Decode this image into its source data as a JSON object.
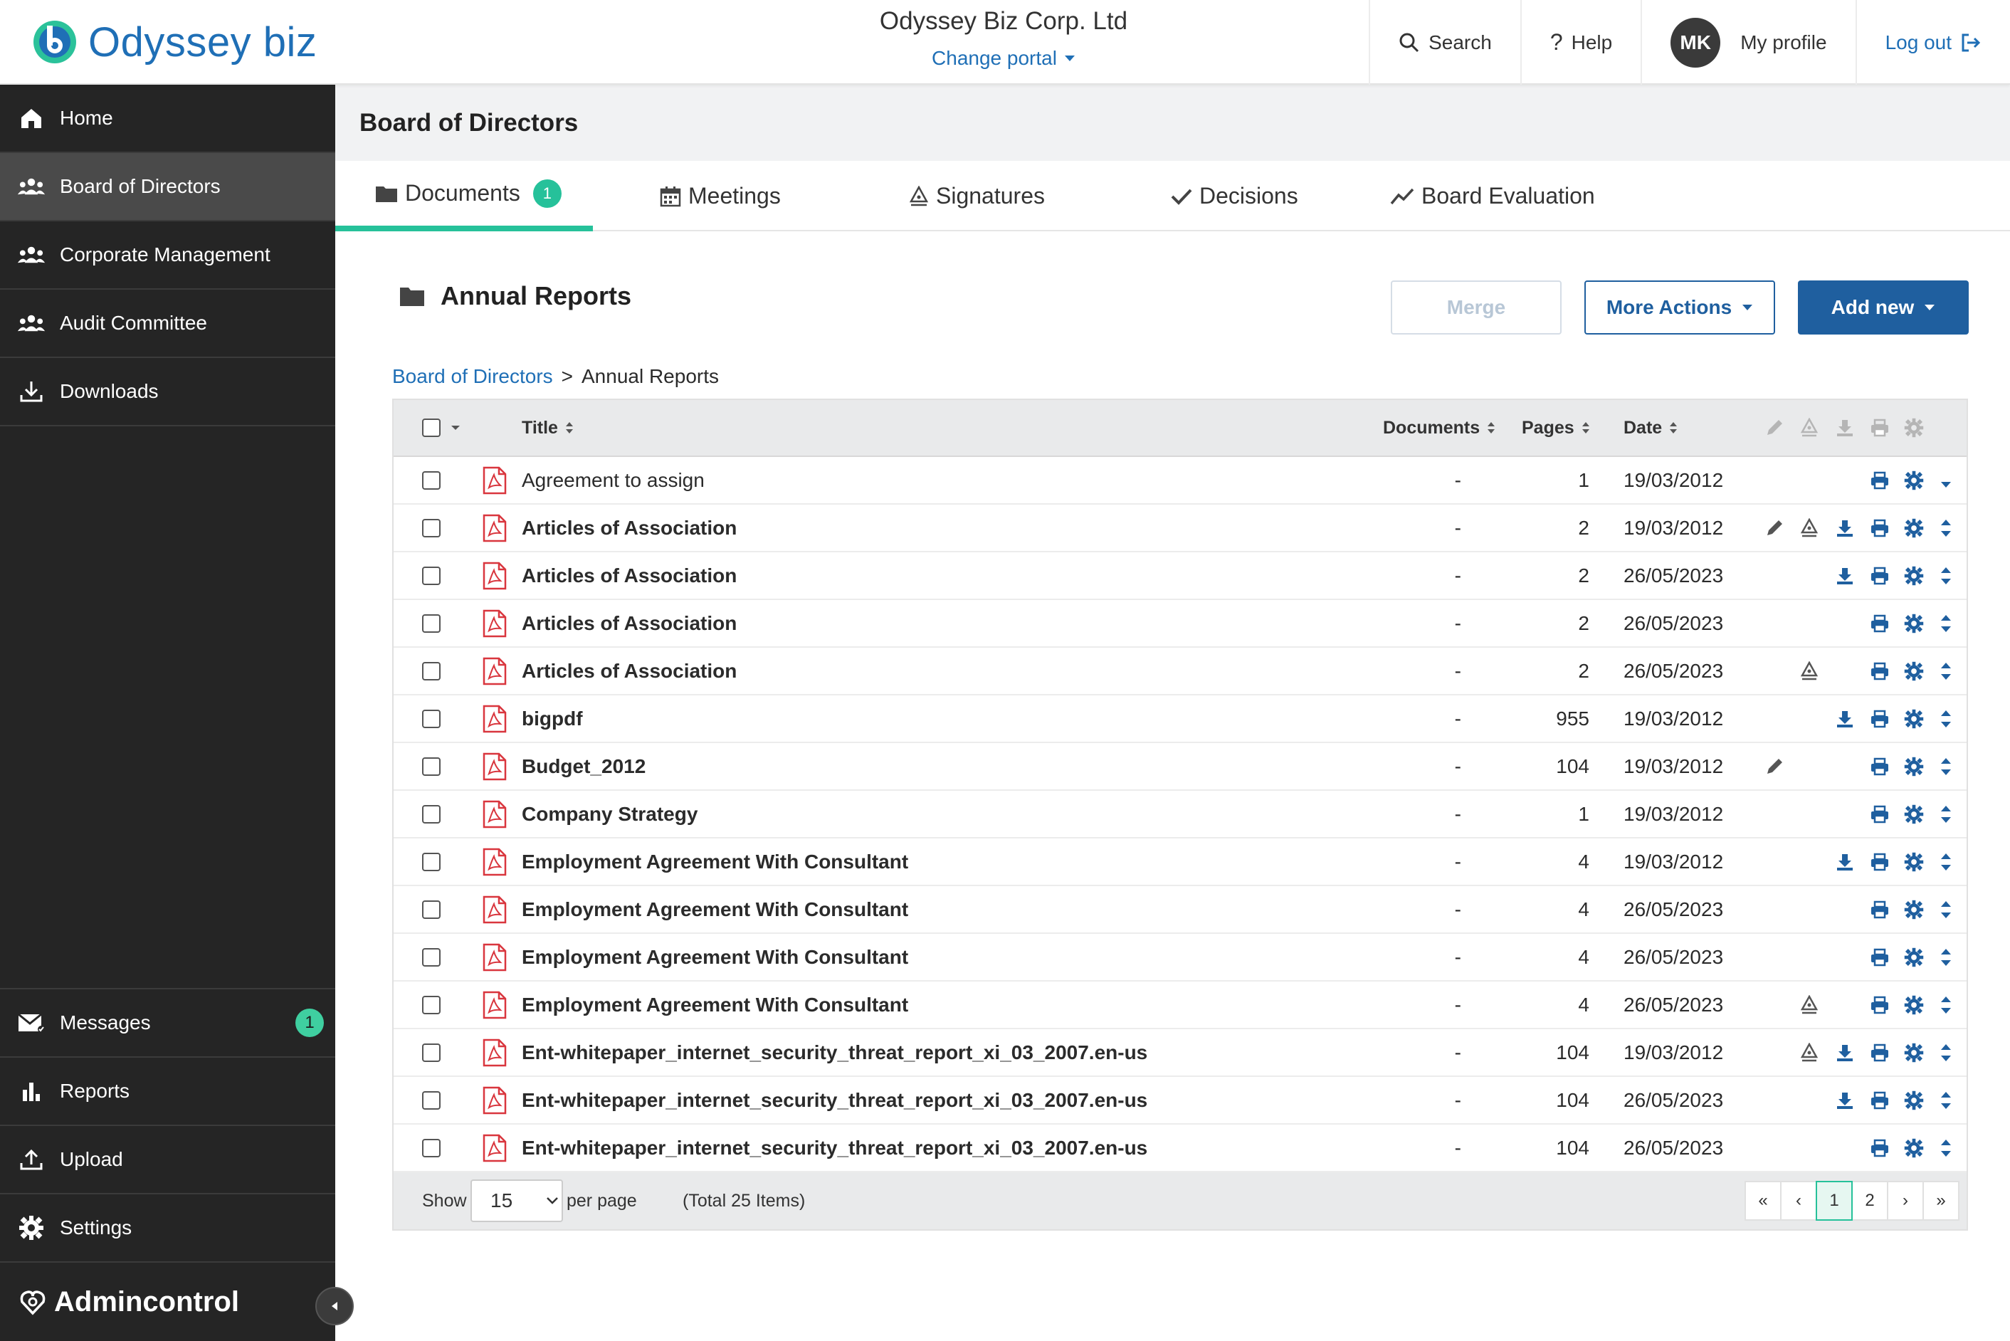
{
  "header": {
    "logo_text": "Odyssey biz",
    "portal_name": "Odyssey Biz Corp. Ltd",
    "change_portal": "Change portal",
    "search": "Search",
    "help": "Help",
    "avatar_initials": "MK",
    "profile": "My profile",
    "logout": "Log out"
  },
  "sidebar": {
    "items": [
      {
        "label": "Home",
        "icon": "home-icon"
      },
      {
        "label": "Board of Directors",
        "icon": "group-icon"
      },
      {
        "label": "Corporate Management",
        "icon": "group-icon"
      },
      {
        "label": "Audit Committee",
        "icon": "group-icon"
      },
      {
        "label": "Downloads",
        "icon": "download-icon"
      }
    ],
    "bottom": [
      {
        "label": "Messages",
        "icon": "mail-icon",
        "badge": "1"
      },
      {
        "label": "Reports",
        "icon": "bar-chart-icon"
      },
      {
        "label": "Upload",
        "icon": "upload-icon"
      },
      {
        "label": "Settings",
        "icon": "gear-icon"
      }
    ],
    "brand": "Admincontrol"
  },
  "page_title": "Board of Directors",
  "tabs": [
    {
      "label": "Documents",
      "badge": "1"
    },
    {
      "label": "Meetings"
    },
    {
      "label": "Signatures"
    },
    {
      "label": "Decisions"
    },
    {
      "label": "Board Evaluation"
    }
  ],
  "section": {
    "title": "Annual Reports",
    "merge": "Merge",
    "more_actions": "More Actions",
    "add_new": "Add new"
  },
  "breadcrumb": {
    "root": "Board of Directors",
    "sep": ">",
    "current": "Annual Reports"
  },
  "table": {
    "columns": {
      "title": "Title",
      "documents": "Documents",
      "pages": "Pages",
      "date": "Date"
    },
    "rows": [
      {
        "title": "Agreement to assign",
        "docs": "-",
        "pages": "1",
        "date": "19/03/2012",
        "bold": false,
        "edit": false,
        "sign": false,
        "download": false
      },
      {
        "title": "Articles of Association",
        "docs": "-",
        "pages": "2",
        "date": "19/03/2012",
        "bold": true,
        "edit": true,
        "sign": true,
        "download": true
      },
      {
        "title": "Articles of Association",
        "docs": "-",
        "pages": "2",
        "date": "26/05/2023",
        "bold": true,
        "edit": false,
        "sign": false,
        "download": true
      },
      {
        "title": "Articles of Association",
        "docs": "-",
        "pages": "2",
        "date": "26/05/2023",
        "bold": true,
        "edit": false,
        "sign": false,
        "download": false
      },
      {
        "title": "Articles of Association",
        "docs": "-",
        "pages": "2",
        "date": "26/05/2023",
        "bold": true,
        "edit": false,
        "sign": true,
        "download": false
      },
      {
        "title": "bigpdf",
        "docs": "-",
        "pages": "955",
        "date": "19/03/2012",
        "bold": true,
        "edit": false,
        "sign": false,
        "download": true
      },
      {
        "title": "Budget_2012",
        "docs": "-",
        "pages": "104",
        "date": "19/03/2012",
        "bold": true,
        "edit": true,
        "sign": false,
        "download": false
      },
      {
        "title": "Company Strategy",
        "docs": "-",
        "pages": "1",
        "date": "19/03/2012",
        "bold": true,
        "edit": false,
        "sign": false,
        "download": false
      },
      {
        "title": "Employment Agreement With Consultant",
        "docs": "-",
        "pages": "4",
        "date": "19/03/2012",
        "bold": true,
        "edit": false,
        "sign": false,
        "download": true
      },
      {
        "title": "Employment Agreement With Consultant",
        "docs": "-",
        "pages": "4",
        "date": "26/05/2023",
        "bold": true,
        "edit": false,
        "sign": false,
        "download": false
      },
      {
        "title": "Employment Agreement With Consultant",
        "docs": "-",
        "pages": "4",
        "date": "26/05/2023",
        "bold": true,
        "edit": false,
        "sign": false,
        "download": false
      },
      {
        "title": "Employment Agreement With Consultant",
        "docs": "-",
        "pages": "4",
        "date": "26/05/2023",
        "bold": true,
        "edit": false,
        "sign": true,
        "download": false
      },
      {
        "title": "Ent-whitepaper_internet_security_threat_report_xi_03_2007.en-us",
        "docs": "-",
        "pages": "104",
        "date": "19/03/2012",
        "bold": true,
        "edit": false,
        "sign": true,
        "download": true
      },
      {
        "title": "Ent-whitepaper_internet_security_threat_report_xi_03_2007.en-us",
        "docs": "-",
        "pages": "104",
        "date": "26/05/2023",
        "bold": true,
        "edit": false,
        "sign": false,
        "download": true
      },
      {
        "title": "Ent-whitepaper_internet_security_threat_report_xi_03_2007.en-us",
        "docs": "-",
        "pages": "104",
        "date": "26/05/2023",
        "bold": true,
        "edit": false,
        "sign": false,
        "download": false
      }
    ]
  },
  "footer": {
    "show": "Show",
    "per_page_value": "15",
    "per_page": "per page",
    "total": "(Total 25 Items)",
    "pager": [
      "«",
      "‹",
      "1",
      "2",
      "›",
      "»"
    ],
    "current_page": "1"
  },
  "colors": {
    "accent": "#26c19a",
    "primary": "#1f5f9f",
    "link": "#1f6fb6",
    "sidebar": "#252525",
    "pdf_red": "#d9363e"
  }
}
